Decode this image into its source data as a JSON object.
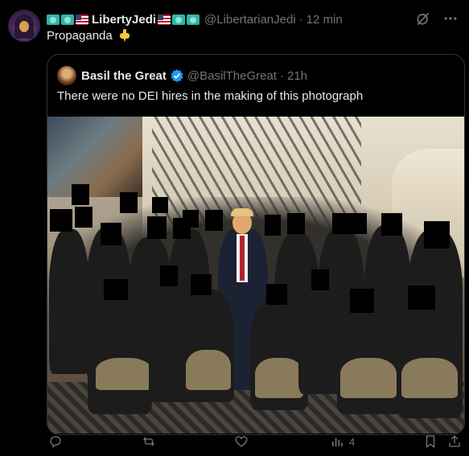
{
  "post": {
    "author_display_name": "LibertyJedi",
    "author_handle": "@LibertarianJedi",
    "separator": "·",
    "time": "12 min",
    "text": "Propaganda",
    "emoji_icons": [
      "statue-of-liberty-icon",
      "statue-of-liberty-icon",
      "us-flag-icon",
      "us-flag-icon",
      "statue-of-liberty-icon",
      "statue-of-liberty-icon"
    ],
    "top_icons": [
      "grok-icon",
      "more-icon"
    ]
  },
  "quote": {
    "author_display_name": "Basil the Great",
    "author_handle": "@BasilTheGreat",
    "separator": "·",
    "time": "21h",
    "text": "There were no DEI hires in the making of this photograph",
    "verified_color": "#1d9bf0"
  },
  "actions": {
    "reply_count": "",
    "repost_count": "",
    "like_count": "",
    "views_count": "4",
    "icons": [
      "reply-icon",
      "repost-icon",
      "like-icon",
      "views-icon",
      "bookmark-icon",
      "share-icon"
    ]
  },
  "colors": {
    "background": "#000000",
    "text_primary": "#e7e9ea",
    "text_secondary": "#71767b",
    "border": "#2f3336",
    "accent": "#1d9bf0"
  }
}
